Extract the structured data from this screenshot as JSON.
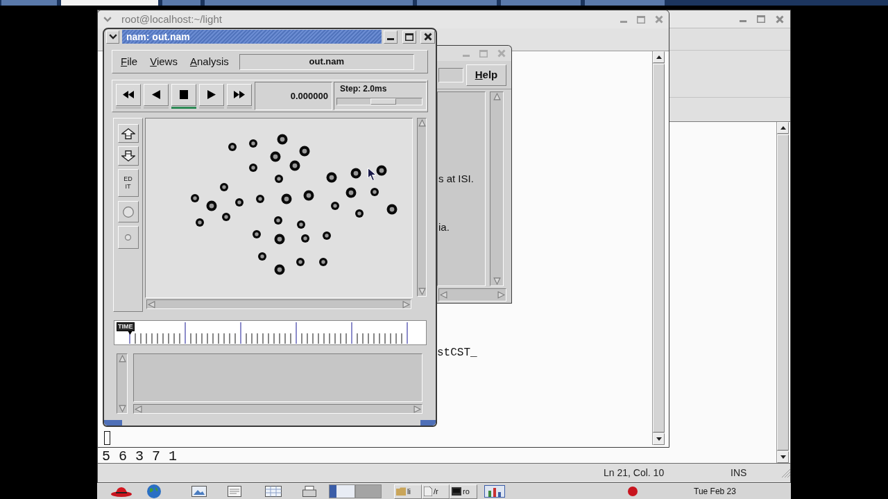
{
  "top_panel": {
    "tabs": [
      {
        "selected": false
      },
      {
        "selected": true
      },
      {
        "selected": false
      },
      {
        "selected": false
      },
      {
        "selected": false
      },
      {
        "selected": false
      },
      {
        "selected": false
      }
    ]
  },
  "terminal_window": {
    "title": "root@localhost:~/light",
    "text_line": "stCST_"
  },
  "nam_window": {
    "title": "nam: out.nam",
    "menu": [
      "File",
      "Views",
      "Analysis"
    ],
    "file_label": "out.nam",
    "transport": [
      {
        "kind": "rewind",
        "selected": false
      },
      {
        "kind": "back",
        "selected": false
      },
      {
        "kind": "stop",
        "selected": true
      },
      {
        "kind": "play",
        "selected": false
      },
      {
        "kind": "forward",
        "selected": false
      }
    ],
    "time": "0.000000",
    "step": {
      "label": "Step: 2.0ms",
      "level": 0.56
    },
    "tools": [
      {
        "kind": "zoom_in"
      },
      {
        "kind": "zoom_out"
      },
      {
        "kind": "edit",
        "label": "EDIT"
      },
      {
        "kind": "circle"
      },
      {
        "kind": "small_circle"
      }
    ],
    "timeline": {
      "label": "TIME",
      "level": 0
    }
  },
  "console_window": {
    "help_button": "Help",
    "text_lines": [
      "s at ISI.",
      "ia."
    ]
  },
  "editor_window": {
    "text_line": "5 6 3 7 1",
    "status_bar": {
      "position": "Ln 21, Col. 10",
      "mode": "INS"
    }
  },
  "taskbar": {
    "workspaces": [
      {
        "selected": true
      },
      {
        "selected": false
      }
    ],
    "tasks": [
      {
        "kind": "folder",
        "label": "li"
      },
      {
        "kind": "file",
        "label": "/r"
      },
      {
        "kind": "terminal",
        "label": "ro"
      }
    ],
    "clock": "Tue Feb 23"
  }
}
